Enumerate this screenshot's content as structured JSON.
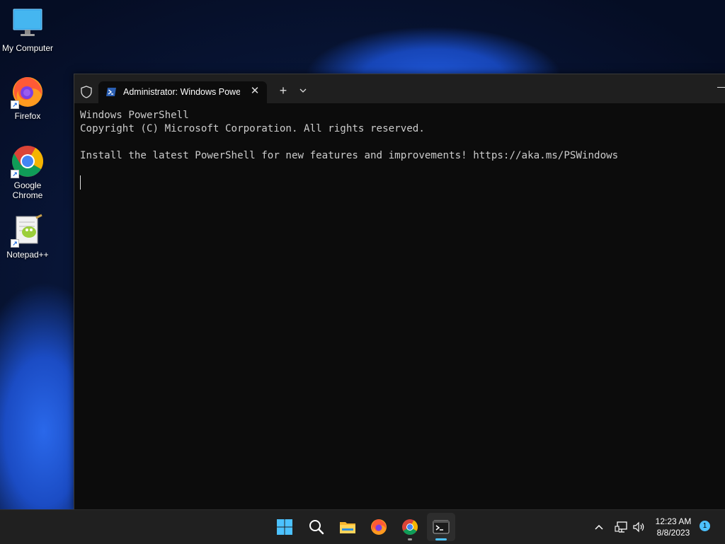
{
  "desktop": {
    "icons": [
      {
        "label": "My Computer",
        "icon": "monitor-icon"
      },
      {
        "label": "Firefox",
        "icon": "firefox-icon"
      },
      {
        "label": "Google Chrome",
        "icon": "chrome-icon"
      },
      {
        "label": "Notepad++",
        "icon": "notepadpp-icon"
      }
    ]
  },
  "terminal": {
    "tab_title": "Administrator: Windows PowerShell",
    "new_tab_label": "+",
    "close_label": "✕",
    "lines": [
      "Windows PowerShell",
      "Copyright (C) Microsoft Corporation. All rights reserved.",
      "",
      "Install the latest PowerShell for new features and improvements! https://aka.ms/PSWindows"
    ]
  },
  "taskbar": {
    "apps": [
      "start-icon",
      "search-icon",
      "file-explorer-icon",
      "firefox-icon",
      "chrome-icon",
      "terminal-icon"
    ],
    "time": "12:23 AM",
    "date": "8/8/2023",
    "notification_count": "1"
  },
  "colors": {
    "accent": "#4cc2ff",
    "console_bg": "#0c0c0c",
    "console_text": "#cccccc"
  }
}
